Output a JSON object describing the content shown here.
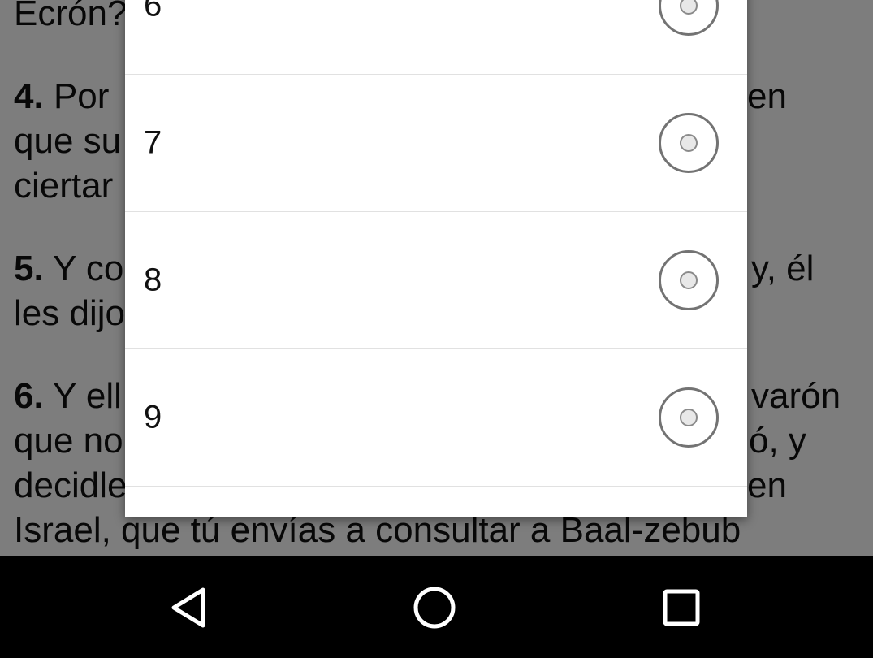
{
  "background_text": {
    "line1": "Ecrón?",
    "v4_num": "4.",
    "v4_start": "Por",
    "v4_end": "en",
    "v4_line2": "que su",
    "v4_line3": "ciertar",
    "v5_num": "5.",
    "v5_start": "Y co",
    "v5_end": "y, él",
    "v5_line2": "les dijo",
    "v6_num": "6.",
    "v6_start": "Y ell",
    "v6_end": "varón",
    "v6_line2": "que no",
    "v6_line2_end": "ó, y",
    "v6_line3": "decidle",
    "v6_line3_end": "en",
    "v6_line4": "Israel, que tú envías a consultar a Baal-zebub"
  },
  "dialog": {
    "options": [
      {
        "label": "6",
        "selected": false
      },
      {
        "label": "7",
        "selected": false
      },
      {
        "label": "8",
        "selected": false
      },
      {
        "label": "9",
        "selected": false
      },
      {
        "label": "",
        "selected": false
      }
    ]
  },
  "navbar": {
    "back_icon": "back-triangle-icon",
    "home_icon": "home-circle-icon",
    "recents_icon": "recents-square-icon",
    "icon_color": "#ffffff"
  }
}
